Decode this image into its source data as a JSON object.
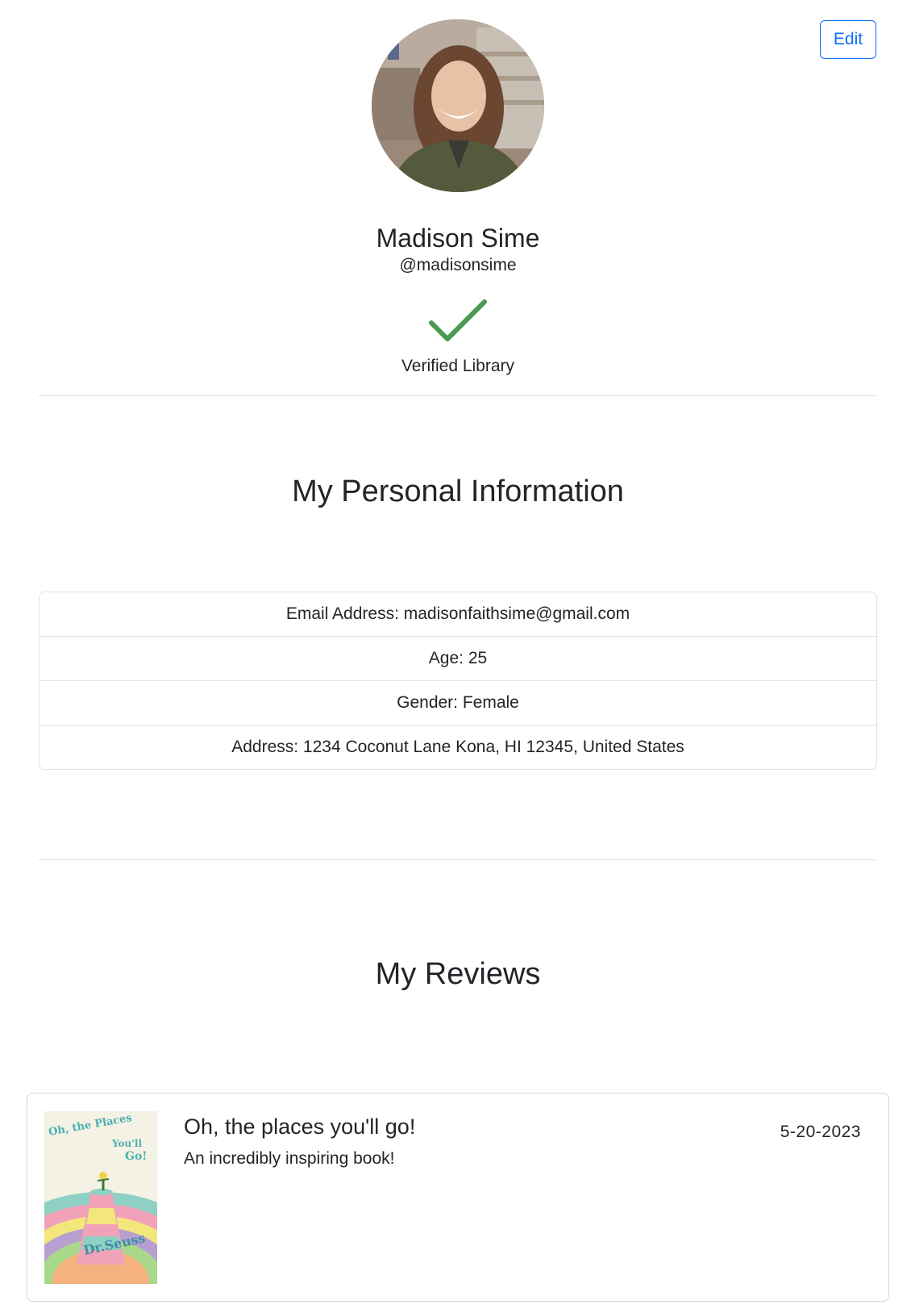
{
  "header": {
    "edit_label": "Edit"
  },
  "profile": {
    "name": "Madison Sime",
    "handle": "@madisonsime",
    "verified_label": "Verified Library",
    "verified_color": "#4a9a52"
  },
  "personal_info": {
    "heading": "My Personal Information",
    "items": [
      "Email Address: madisonfaithsime@gmail.com",
      "Age: 25",
      "Gender: Female",
      "Address: 1234 Coconut Lane Kona, HI 12345, United States"
    ]
  },
  "reviews": {
    "heading": "My Reviews",
    "items": [
      {
        "title": "Oh, the places you'll go!",
        "body": "An incredibly inspiring book!",
        "date": "5-20-2023",
        "cover_title_text": "Oh, the Places You'll Go!",
        "cover_author_text": "by Dr. Seuss"
      }
    ]
  },
  "colors": {
    "accent": "#0d6efd",
    "text": "#212529",
    "border": "#dee2e6"
  }
}
